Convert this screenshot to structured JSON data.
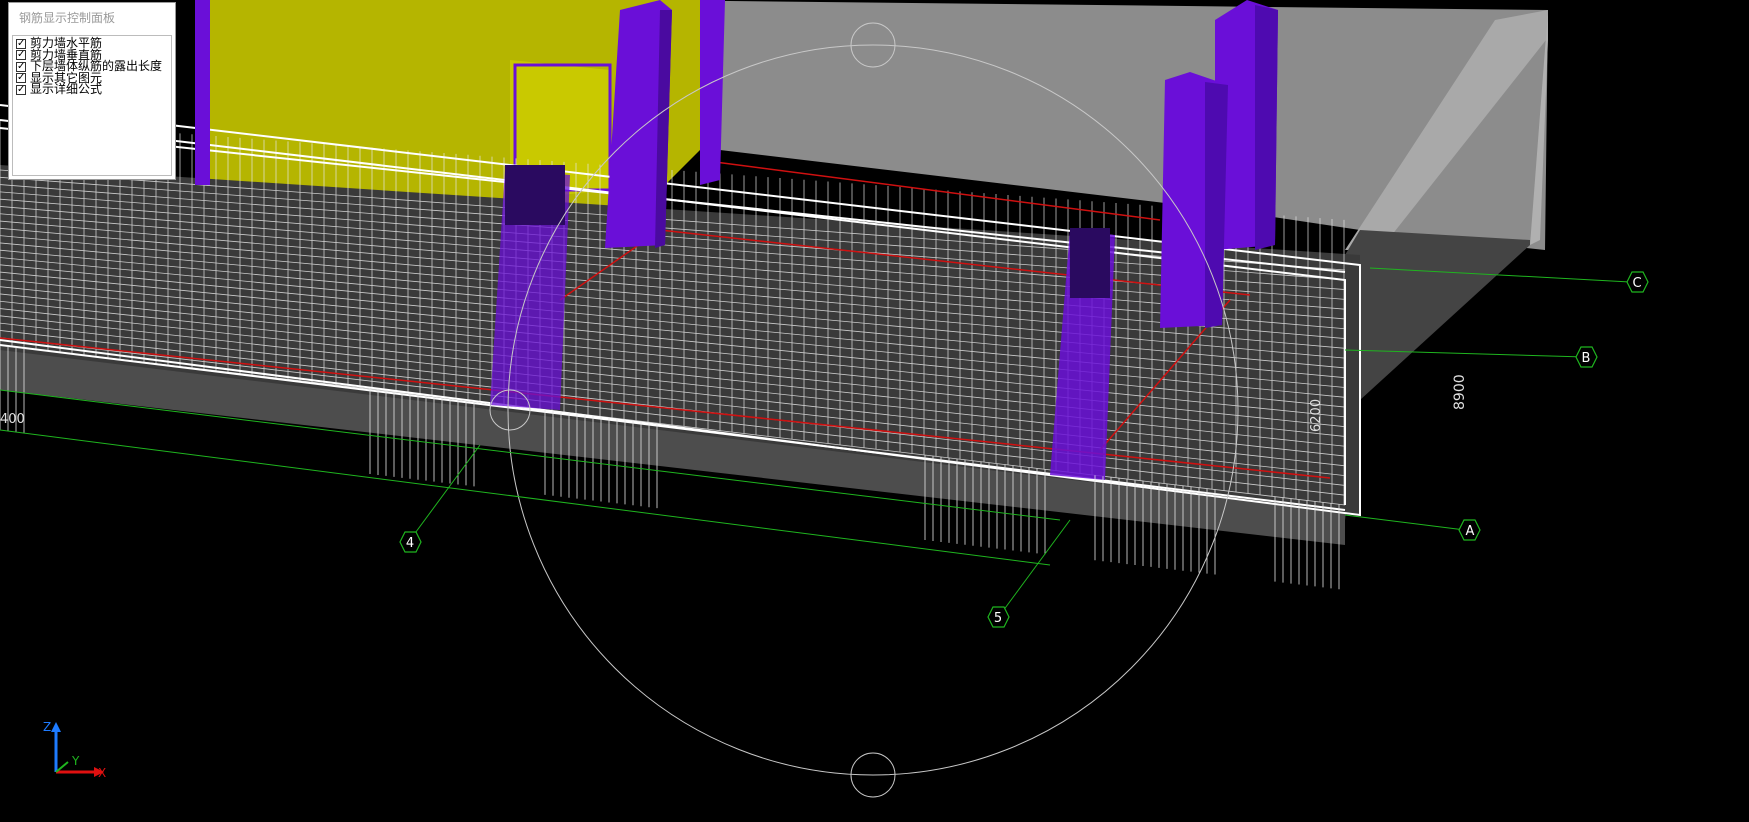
{
  "panel": {
    "title": "钢筋显示控制面板",
    "options": [
      {
        "label": "剪力墙水平筋",
        "checked": true
      },
      {
        "label": "剪力墙垂直筋",
        "checked": true
      },
      {
        "label": "下层墙体纵筋的露出长度",
        "checked": true
      },
      {
        "label": "显示其它图元",
        "checked": true
      },
      {
        "label": "显示详细公式",
        "checked": true
      }
    ]
  },
  "grid_axes": {
    "rows": [
      "A",
      "B",
      "C"
    ],
    "columns": [
      "4",
      "5"
    ]
  },
  "dimensions": {
    "d8900": "8900",
    "d6200": "6200",
    "d400": "400"
  },
  "coordinate_triad": {
    "x": "X",
    "y": "Y",
    "z": "Z"
  },
  "colors": {
    "background": "#000000",
    "wall_yellow": "#b5b500",
    "column_purple": "#6a0fd8",
    "slab_gray": "#808080",
    "grid_green": "#1fb51f",
    "rebar_white": "#e8e8e8",
    "rebar_red": "#d01010"
  }
}
